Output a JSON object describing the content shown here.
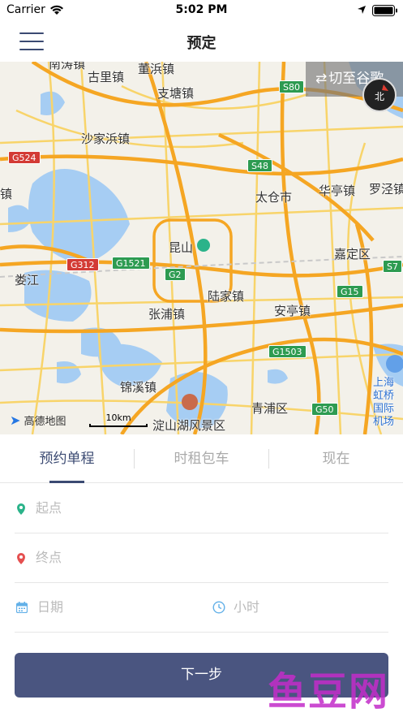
{
  "status_bar": {
    "carrier": "Carrier",
    "time": "5:02 PM"
  },
  "nav": {
    "title": "预定",
    "menu_icon": "hamburger-menu-icon"
  },
  "map": {
    "switch_label": "切至谷歌",
    "compass_label": "北",
    "logo": "高德地图",
    "scale": "10km",
    "place_labels": [
      "南涛镇",
      "古里镇",
      "董浜镇",
      "支塘镇",
      "沙家浜镇",
      "太仓市",
      "华亭镇",
      "罗泾镇",
      "镇",
      "昆山",
      "嘉定区",
      "娄江",
      "陆家镇",
      "张浦镇",
      "安亭镇",
      "锦溪镇",
      "青浦区",
      "淀山湖风景区",
      "上海虹桥国际机场"
    ],
    "road_badges": [
      "S80",
      "G524",
      "S48",
      "G312",
      "G1521",
      "G2",
      "G15",
      "S7",
      "G1503",
      "G50"
    ],
    "colors": {
      "water": "#a6cdf3",
      "land": "#f3f1ea",
      "highway": "#f5a623",
      "road": "#f8d46a"
    }
  },
  "tabs": [
    {
      "label": "预约单程",
      "active": true
    },
    {
      "label": "时租包车",
      "active": false
    },
    {
      "label": "现在",
      "active": false
    }
  ],
  "form": {
    "start_placeholder": "起点",
    "end_placeholder": "终点",
    "date_placeholder": "日期",
    "hours_placeholder": "小时"
  },
  "next_button": "下一步",
  "watermark": "鱼豆网",
  "colors": {
    "accent": "#3b4a72",
    "button": "#4a5580",
    "start_pin": "#2bb38a",
    "end_pin": "#e55050",
    "icon_blue": "#62b0e8"
  }
}
